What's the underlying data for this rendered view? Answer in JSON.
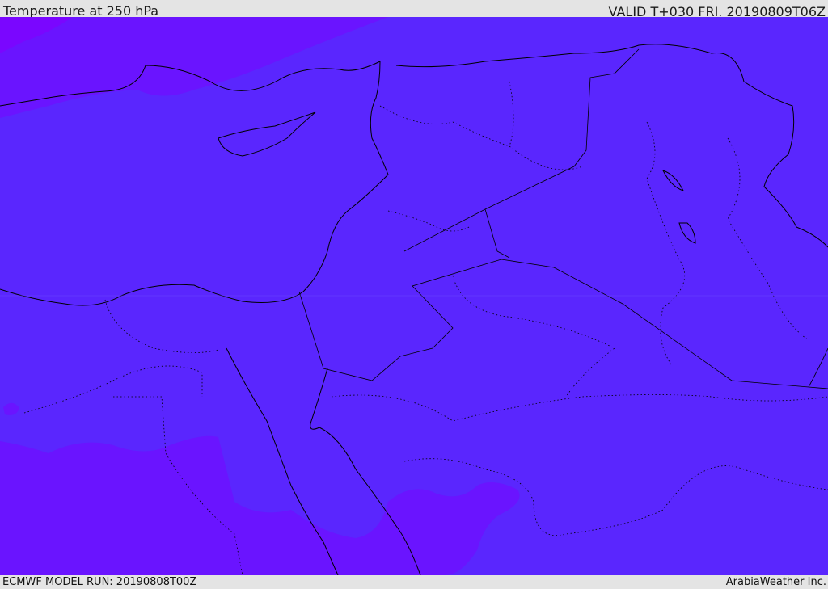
{
  "header": {
    "title": "Temperature at 250 hPa",
    "valid": "VALID T+030 FRI. 20190809T06Z"
  },
  "footer": {
    "model_run": "ECMWF MODEL RUN: 20190808T00Z",
    "brand": "ArabiaWeather Inc."
  },
  "colors": {
    "base": "#5a26fe",
    "warm_band": "#6a12ff",
    "coldest": "#8000ff",
    "background": "#e4e4e4"
  }
}
